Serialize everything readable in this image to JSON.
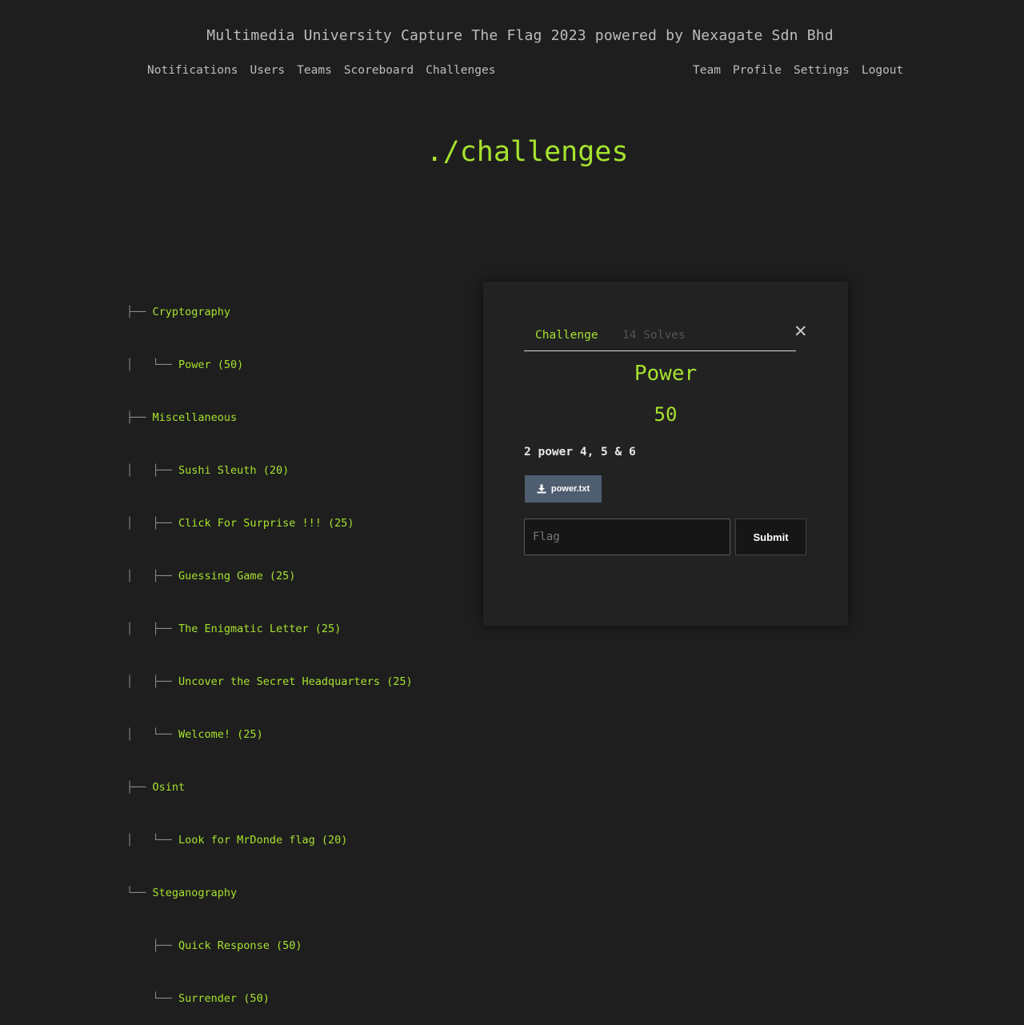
{
  "site_title": "Multimedia University Capture The Flag 2023 powered by Nexagate Sdn Bhd",
  "nav_left": [
    "Notifications",
    "Users",
    "Teams",
    "Scoreboard",
    "Challenges"
  ],
  "nav_right": [
    "Team",
    "Profile",
    "Settings",
    "Logout"
  ],
  "page_heading": "./challenges",
  "tree": [
    {
      "prefix": "├── ",
      "label": "Cryptography"
    },
    {
      "prefix": "│   └── ",
      "label": "Power (50)"
    },
    {
      "prefix": "├── ",
      "label": "Miscellaneous"
    },
    {
      "prefix": "│   ├── ",
      "label": "Sushi Sleuth (20)"
    },
    {
      "prefix": "│   ├── ",
      "label": "Click For Surprise !!! (25)"
    },
    {
      "prefix": "│   ├── ",
      "label": "Guessing Game (25)"
    },
    {
      "prefix": "│   ├── ",
      "label": "The Enigmatic Letter (25)"
    },
    {
      "prefix": "│   ├── ",
      "label": "Uncover the Secret Headquarters (25)"
    },
    {
      "prefix": "│   └── ",
      "label": "Welcome! (25)"
    },
    {
      "prefix": "├── ",
      "label": "Osint"
    },
    {
      "prefix": "│   └── ",
      "label": "Look for MrDonde flag (20)"
    },
    {
      "prefix": "└── ",
      "label": "Steganography"
    },
    {
      "prefix": "    ├── ",
      "label": "Quick Response (50)"
    },
    {
      "prefix": "    └── ",
      "label": "Surrender (50)"
    }
  ],
  "modal": {
    "tab_challenge": "Challenge",
    "tab_solves": "14 Solves",
    "close_symbol": "✕",
    "name": "Power",
    "value": "50",
    "description": "2 power 4, 5 & 6",
    "file_label": "power.txt",
    "flag_placeholder": "Flag",
    "submit_label": "Submit"
  },
  "colors": {
    "accent": "#a6e22e",
    "background": "#1e1e1e",
    "panel": "#222222",
    "file_button": "#4e5d70"
  }
}
